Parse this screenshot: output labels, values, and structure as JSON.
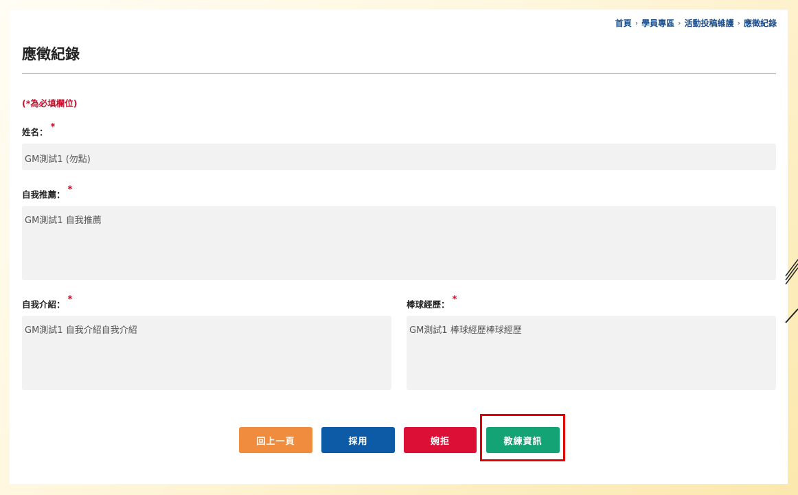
{
  "breadcrumb": {
    "items": [
      "首頁",
      "學員專區",
      "活動投稿維護",
      "應徵紀錄"
    ],
    "separator": "›"
  },
  "page_title": "應徵紀錄",
  "required_note": "(*為必填欄位)",
  "fields": {
    "name": {
      "label": "姓名：",
      "required_mark": "*",
      "value": "GM測試1 (勿點)"
    },
    "self_recommend": {
      "label": "自我推薦：",
      "required_mark": "*",
      "value": "GM測試1 自我推薦"
    },
    "self_intro": {
      "label": "自我介紹：",
      "required_mark": "*",
      "value": "GM測試1 自我介紹自我介紹"
    },
    "baseball_experience": {
      "label": "棒球經歷：",
      "required_mark": "*",
      "value": "GM測試1 棒球經歷棒球經歷"
    }
  },
  "buttons": {
    "back": "回上一頁",
    "accept": "採用",
    "reject": "婉拒",
    "coach_info": "教練資訊"
  },
  "colors": {
    "back": "#f08c3e",
    "accept": "#0d5aa7",
    "reject": "#dc1037",
    "coach_info": "#14a374",
    "highlight": "#e20000",
    "required": "#c8102e",
    "breadcrumb": "#1d4f8c"
  }
}
